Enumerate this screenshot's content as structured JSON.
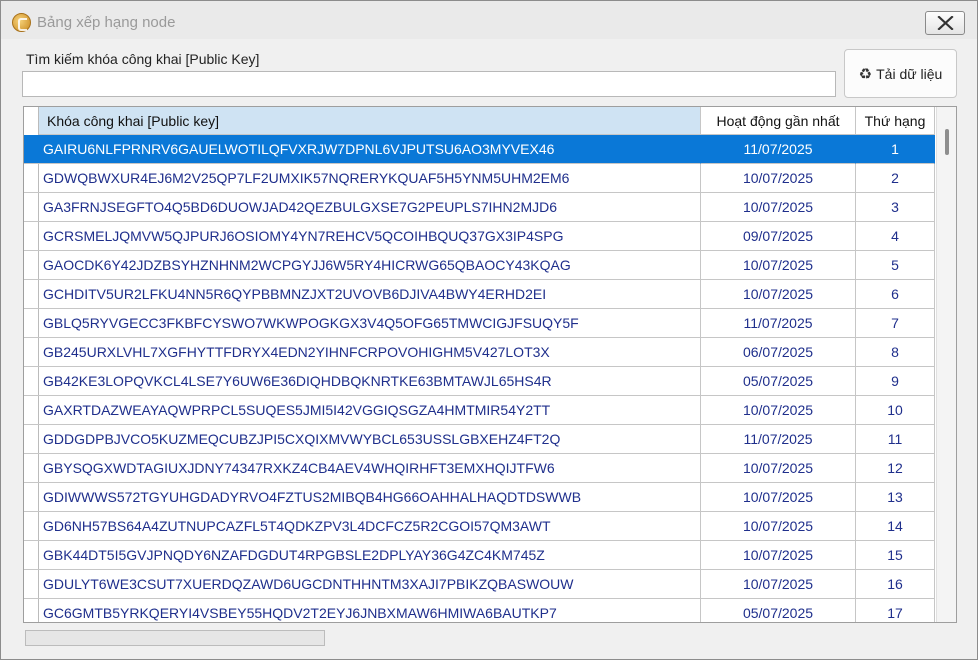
{
  "window": {
    "title": "Bảng xếp hạng node"
  },
  "icons": {
    "app": "app-coin-icon",
    "close": "close-icon",
    "reload": "recycle-icon"
  },
  "search": {
    "label": "Tìm kiếm khóa công khai [Public Key]",
    "value": "",
    "placeholder": ""
  },
  "load_button": {
    "icon": "♻",
    "label": "Tải dữ liệu"
  },
  "table": {
    "columns": [
      "Khóa công khai [Public key]",
      "Hoạt động gần nhất",
      "Thứ hạng"
    ],
    "selected_index": 0,
    "rows": [
      {
        "key": "GAIRU6NLFPRNRV6GAUELWOTILQFVXRJW7DPNL6VJPUTSU6AO3MYVEX46",
        "date": "11/07/2025",
        "rank": "1"
      },
      {
        "key": "GDWQBWXUR4EJ6M2V25QP7LF2UMXIK57NQRERYKQUAF5H5YNM5UHM2EM6",
        "date": "10/07/2025",
        "rank": "2"
      },
      {
        "key": "GA3FRNJSEGFTO4Q5BD6DUOWJAD42QEZBULGXSE7G2PEUPLS7IHN2MJD6",
        "date": "10/07/2025",
        "rank": "3"
      },
      {
        "key": "GCRSMELJQMVW5QJPURJ6OSIOMY4YN7REHCV5QCOIHBQUQ37GX3IP4SPG",
        "date": "09/07/2025",
        "rank": "4"
      },
      {
        "key": "GAOCDK6Y42JDZBSYHZNHNM2WCPGYJJ6W5RY4HICRWG65QBAOCY43KQAG",
        "date": "10/07/2025",
        "rank": "5"
      },
      {
        "key": "GCHDITV5UR2LFKU4NN5R6QYPBBMNZJXT2UVOVB6DJIVA4BWY4ERHD2EI",
        "date": "10/07/2025",
        "rank": "6"
      },
      {
        "key": "GBLQ5RYVGECC3FKBFCYSWO7WKWPOGKGX3V4Q5OFG65TMWCIGJFSUQY5F",
        "date": "11/07/2025",
        "rank": "7"
      },
      {
        "key": "GB245URXLVHL7XGFHYTTFDRYX4EDN2YIHNFCRPOVOHIGHM5V427LOT3X",
        "date": "06/07/2025",
        "rank": "8"
      },
      {
        "key": "GB42KE3LOPQVKCL4LSE7Y6UW6E36DIQHDBQKNRTKE63BMTAWJL65HS4R",
        "date": "05/07/2025",
        "rank": "9"
      },
      {
        "key": "GAXRTDAZWEAYAQWPRPCL5SUQES5JMI5I42VGGIQSGZA4HMTMIR54Y2TT",
        "date": "10/07/2025",
        "rank": "10"
      },
      {
        "key": "GDDGDPBJVCO5KUZMEQCUBZJPI5CXQIXMVWYBCL653USSLGBXEHZ4FT2Q",
        "date": "11/07/2025",
        "rank": "11"
      },
      {
        "key": "GBYSQGXWDTAGIUXJDNY74347RXKZ4CB4AEV4WHQIRHFT3EMXHQIJTFW6",
        "date": "10/07/2025",
        "rank": "12"
      },
      {
        "key": "GDIWWWS572TGYUHGDADYRVO4FZTUS2MIBQB4HG66OAHHALHAQDTDSWWB",
        "date": "10/07/2025",
        "rank": "13"
      },
      {
        "key": "GD6NH57BS64A4ZUTNUPCAZFL5T4QDKZPV3L4DCFCZ5R2CGOI57QM3AWT",
        "date": "10/07/2025",
        "rank": "14"
      },
      {
        "key": "GBK44DT5I5GVJPNQDY6NZAFDGDUT4RPGBSLE2DPLYAY36G4ZC4KM745Z",
        "date": "10/07/2025",
        "rank": "15"
      },
      {
        "key": "GDULYT6WE3CSUT7XUERDQZAWD6UGCDNTHHNTM3XAJI7PBIKZQBASWOUW",
        "date": "10/07/2025",
        "rank": "16"
      },
      {
        "key": "GC6GMTB5YRKQERYI4VSBEY55HQDV2T2EYJ6JNBXMAW6HMIWA6BAUTKP7",
        "date": "05/07/2025",
        "rank": "17"
      }
    ]
  },
  "status": {
    "progress_fraction": 0
  },
  "colors": {
    "selection": "#0a78d7",
    "cell_text": "#1f2f8c",
    "header_highlight": "#cfe3f3"
  }
}
